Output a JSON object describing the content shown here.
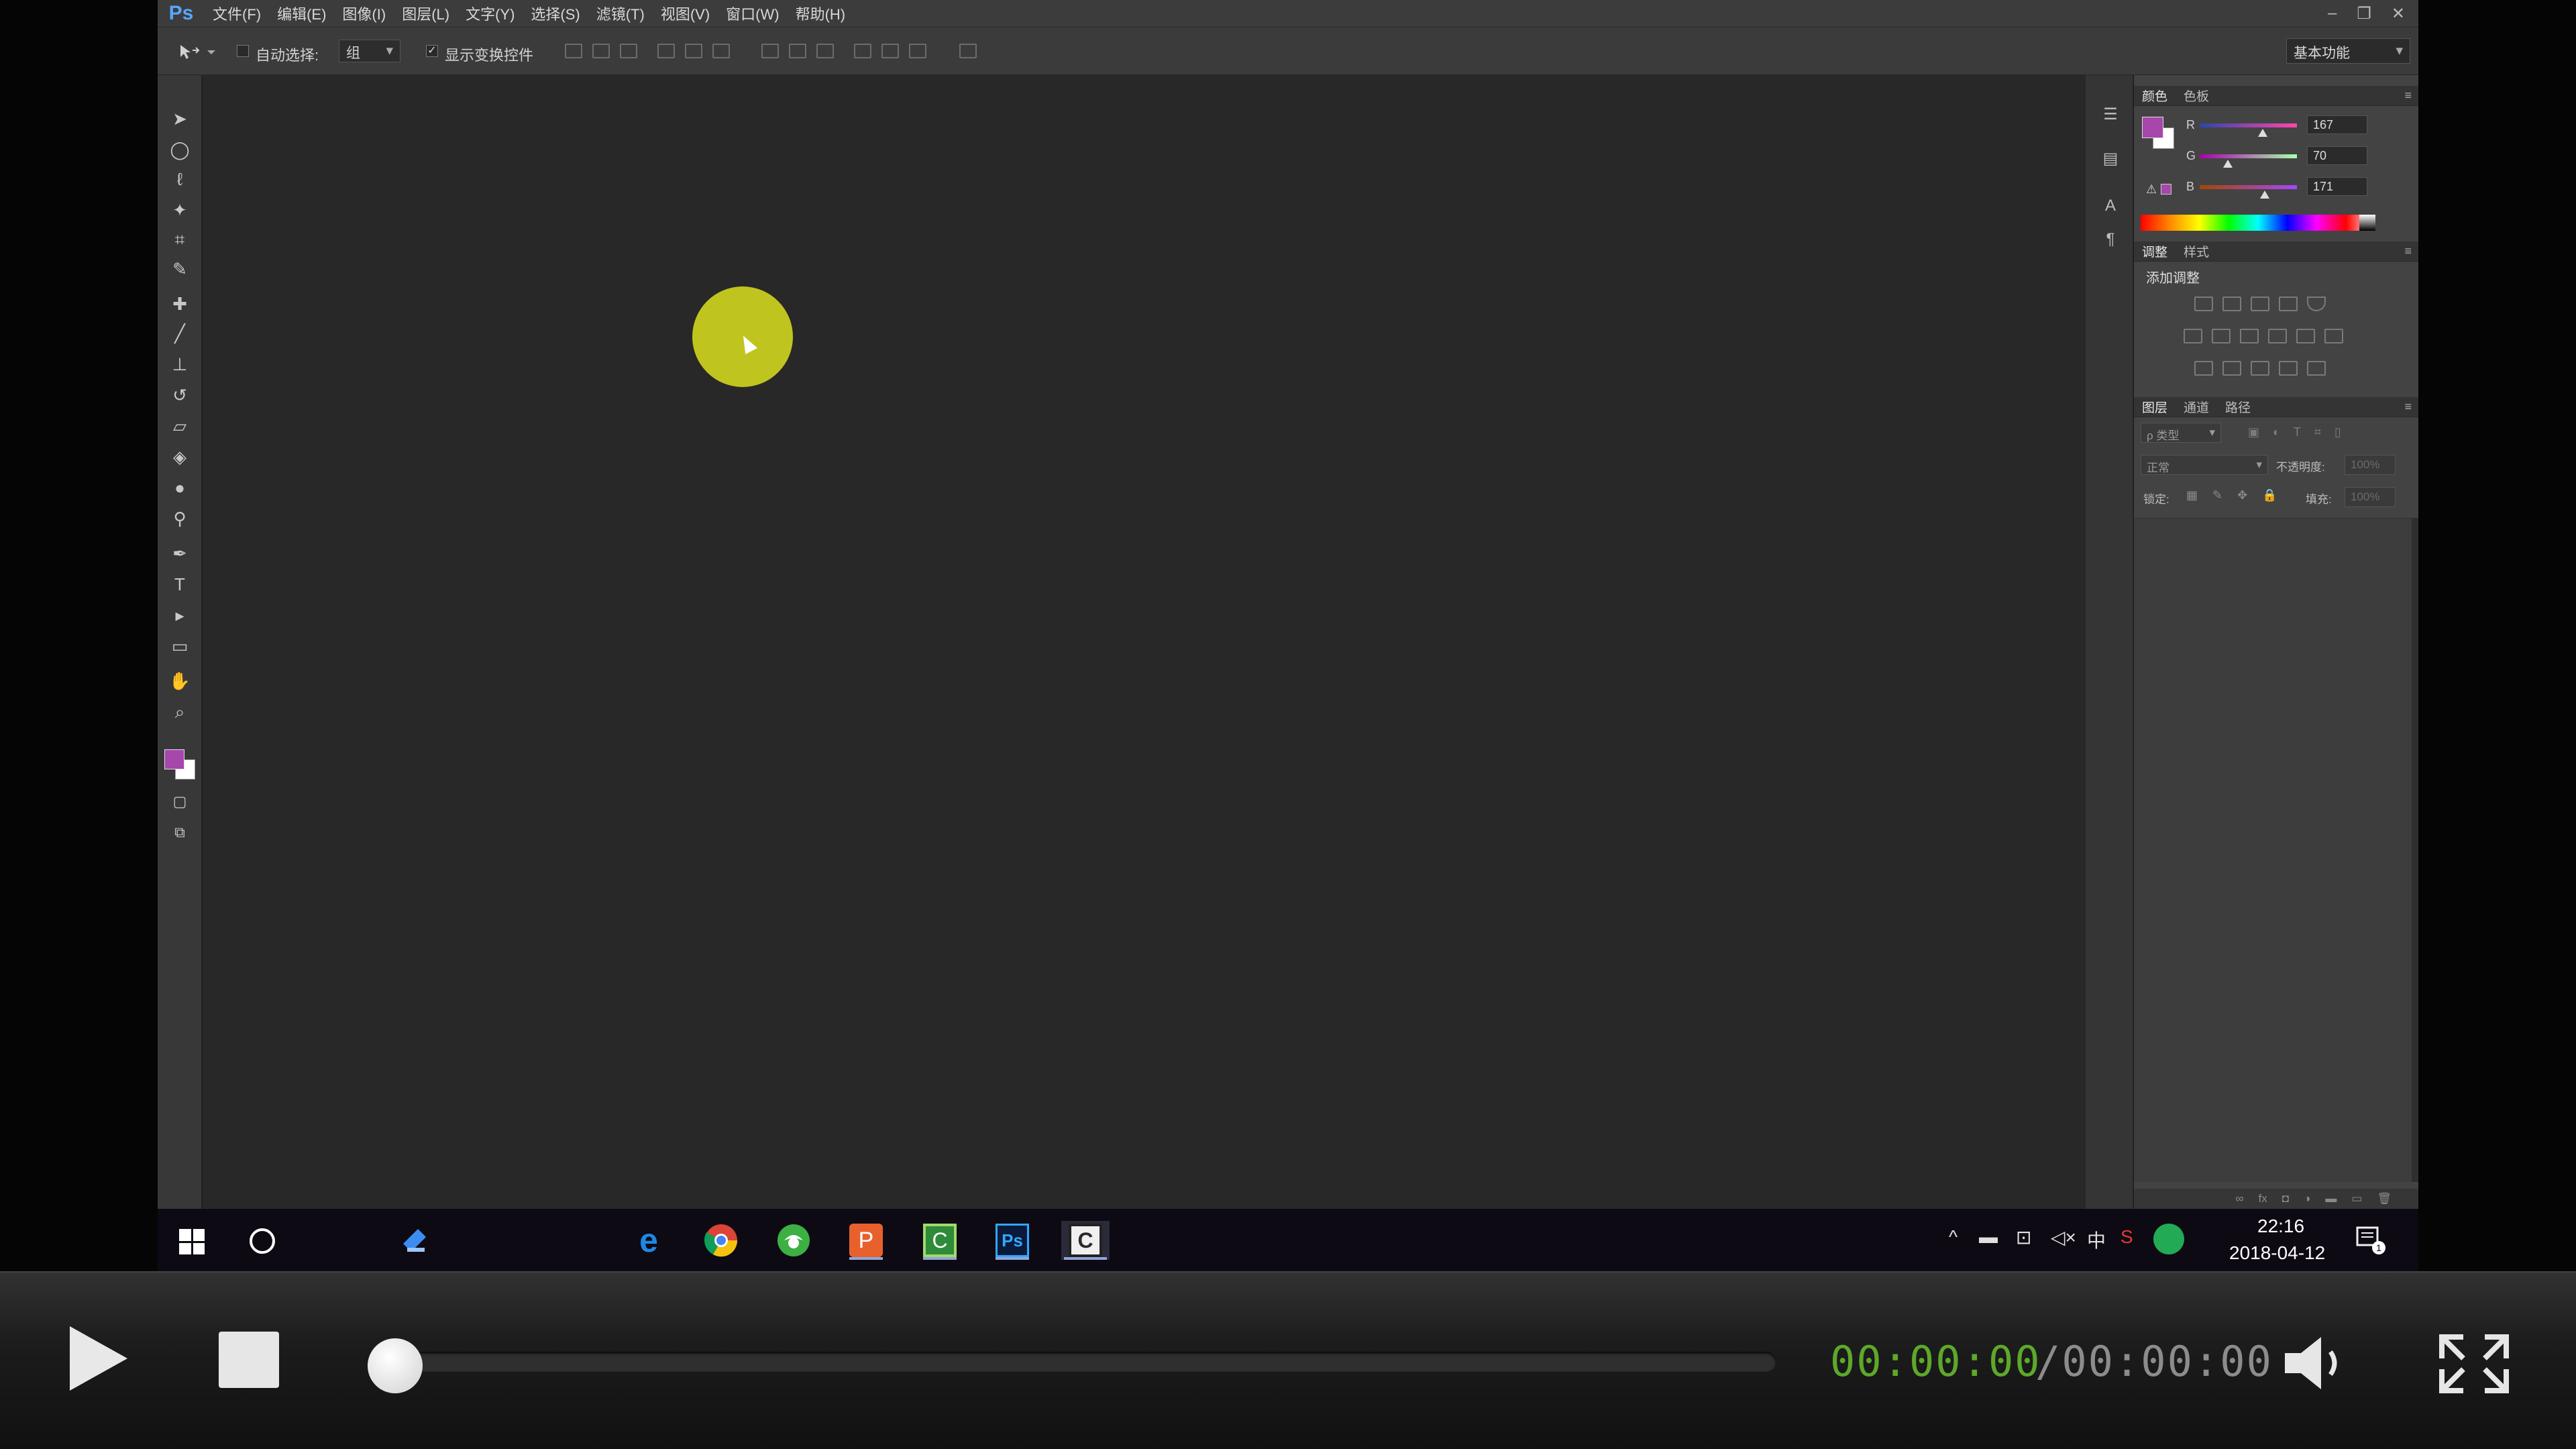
{
  "app": {
    "logo": "Ps",
    "menus": [
      "文件(F)",
      "编辑(E)",
      "图像(I)",
      "图层(L)",
      "文字(Y)",
      "选择(S)",
      "滤镜(T)",
      "视图(V)",
      "窗口(W)",
      "帮助(H)"
    ],
    "window_controls": [
      "–",
      "❐",
      "✕"
    ]
  },
  "options": {
    "auto_select_label": "自动选择:",
    "auto_select_value": "组",
    "show_transform_label": "显示变换控件",
    "workspace": "基本功能"
  },
  "colors": {
    "foreground": "#a746ab",
    "background": "#ffffff",
    "cursor_highlight": "#c8cc1e",
    "timecode_current": "#5da82a"
  },
  "color_panel": {
    "tabs": [
      "颜色",
      "色板"
    ],
    "channels": [
      {
        "label": "R",
        "value": "167"
      },
      {
        "label": "G",
        "value": "70"
      },
      {
        "label": "B",
        "value": "171"
      }
    ]
  },
  "adjust_panel": {
    "tabs": [
      "调整",
      "样式"
    ],
    "title": "添加调整"
  },
  "layers_panel": {
    "tabs": [
      "图层",
      "通道",
      "路径"
    ],
    "filter_label": "ρ 类型",
    "blend_mode": "正常",
    "opacity_label": "不透明度:",
    "opacity_value": "100%",
    "lock_label": "锁定:",
    "fill_label": "填充:",
    "fill_value": "100%"
  },
  "taskbar": {
    "time": "22:16",
    "date": "2018-04-12",
    "ime": "中",
    "notification_count": "1",
    "apps": [
      "explorer-icon",
      "edge-icon",
      "chrome-icon",
      "browser360-icon",
      "powerpoint-icon",
      "camtasia-icon",
      "photoshop-icon",
      "camtasia-recorder-icon"
    ]
  },
  "player": {
    "current_time": "00:00:00",
    "total_time": "/00:00:00",
    "progress": 0
  }
}
